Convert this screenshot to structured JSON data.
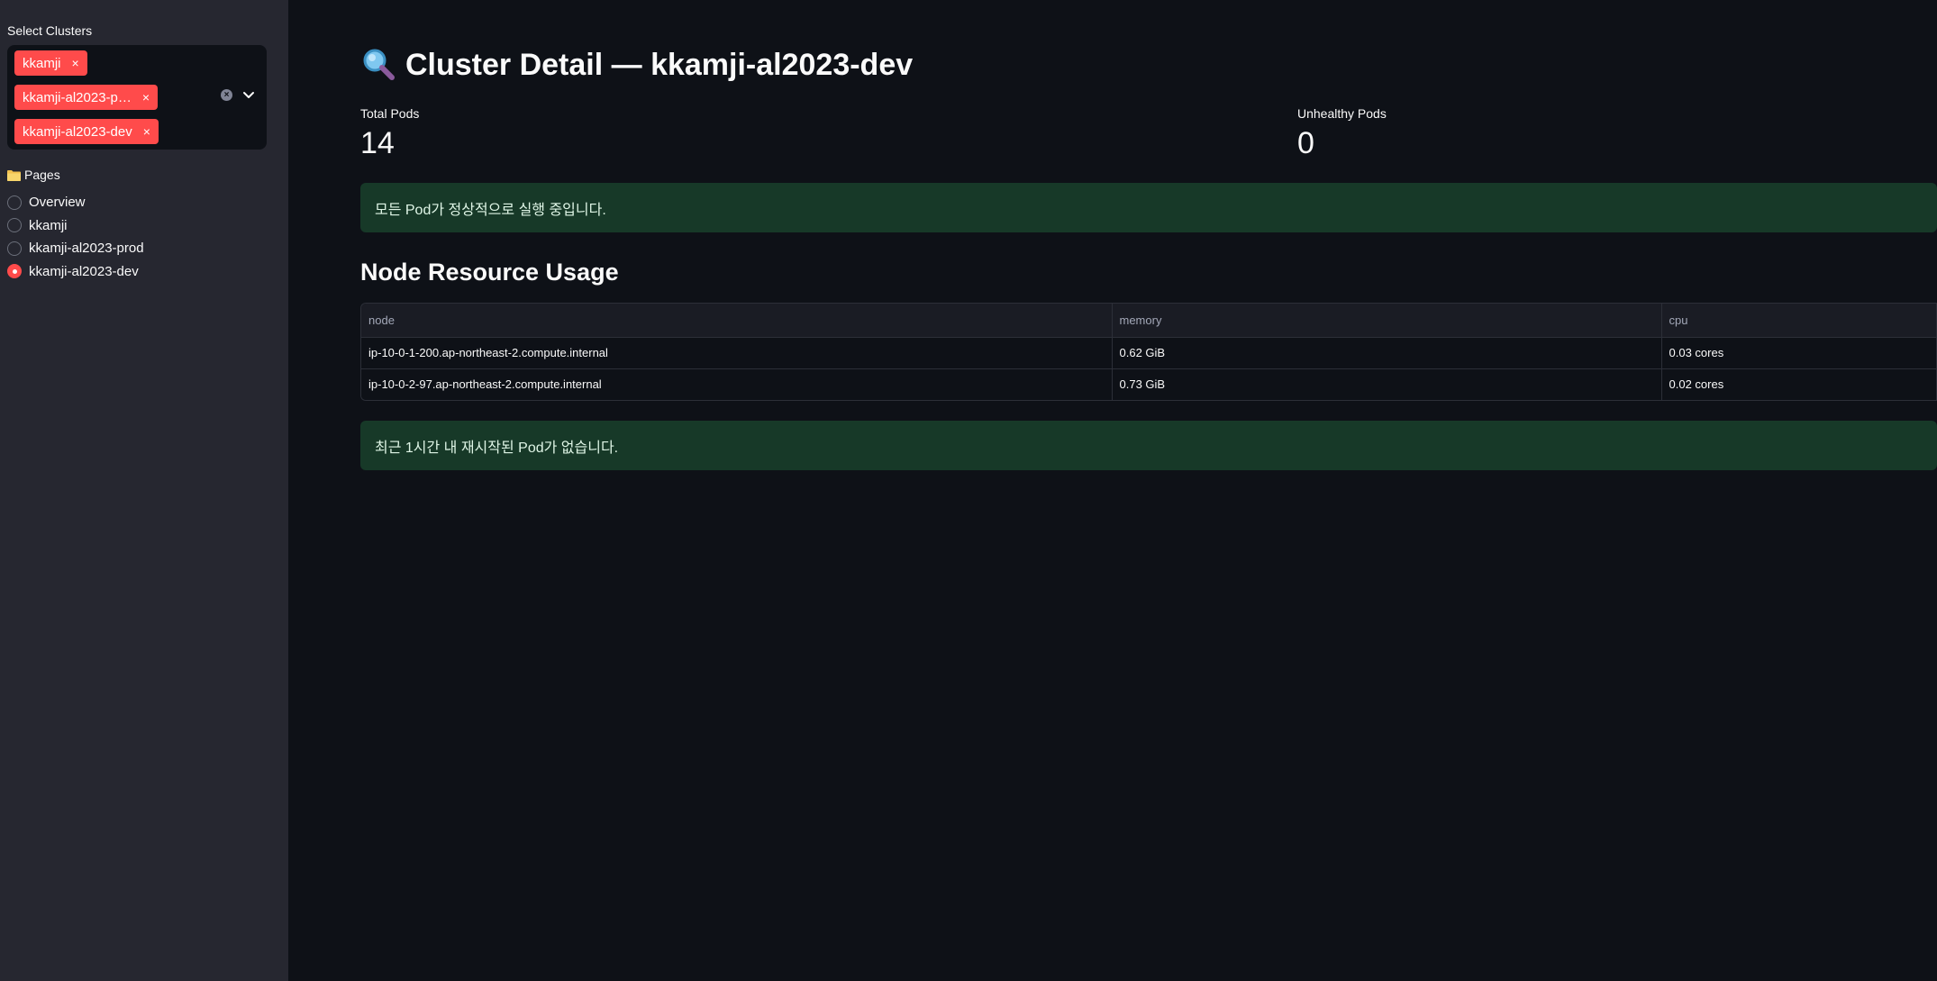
{
  "sidebar": {
    "select_label": "Select Clusters",
    "selected_clusters": [
      "kkamji",
      "kkamji-al2023-p…",
      "kkamji-al2023-dev"
    ],
    "chip_remove_glyph": "×",
    "pages_title": "Pages",
    "pages": [
      {
        "label": "Overview",
        "checked": false
      },
      {
        "label": "kkamji",
        "checked": false
      },
      {
        "label": "kkamji-al2023-prod",
        "checked": false
      },
      {
        "label": "kkamji-al2023-dev",
        "checked": true
      }
    ]
  },
  "main": {
    "title": "Cluster Detail — kkamji-al2023-dev",
    "metrics": [
      {
        "label": "Total Pods",
        "value": "14"
      },
      {
        "label": "Unhealthy Pods",
        "value": "0"
      }
    ],
    "pods_status_message": "모든 Pod가 정상적으로 실행 중입니다.",
    "section_title": "Node Resource Usage",
    "table": {
      "columns": [
        "node",
        "memory",
        "cpu"
      ],
      "rows": [
        [
          "ip-10-0-1-200.ap-northeast-2.compute.internal",
          "0.62 GiB",
          "0.03 cores"
        ],
        [
          "ip-10-0-2-97.ap-northeast-2.compute.internal",
          "0.73 GiB",
          "0.02 cores"
        ]
      ]
    },
    "restart_message": "최근 1시간 내 재시작된 Pod가 없습니다."
  },
  "colors": {
    "accent": "#ff4b4b",
    "background": "#0e1117",
    "sidebar": "#262730",
    "success_bg": "#173928"
  },
  "icons": {
    "title_icon": "magnifying-glass-icon",
    "pages_icon": "folder-icon"
  }
}
